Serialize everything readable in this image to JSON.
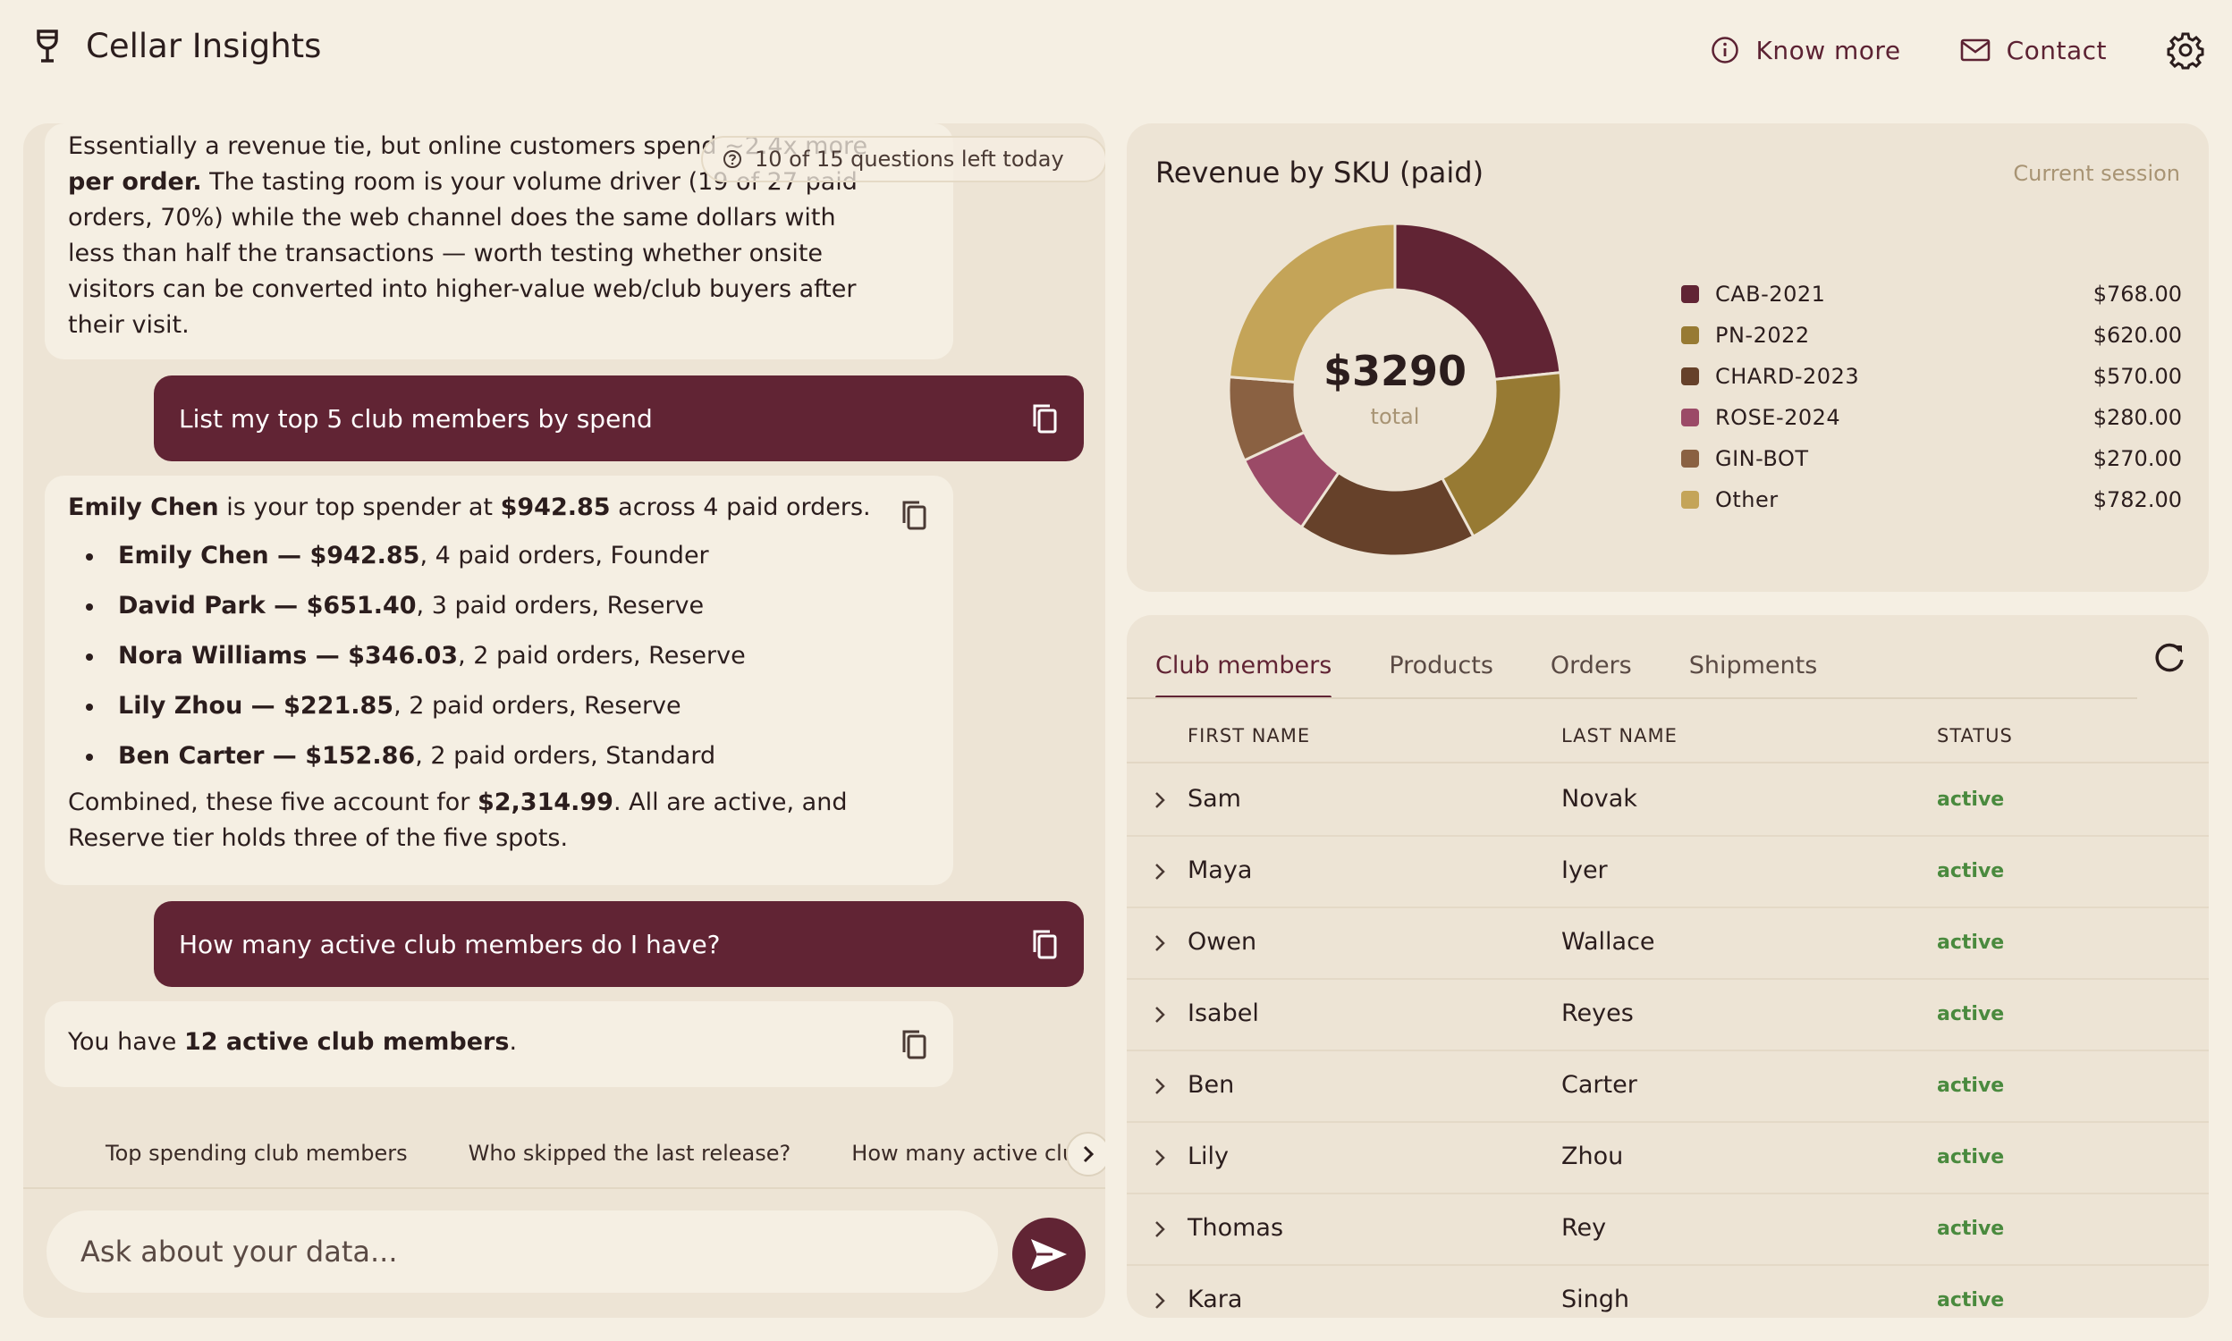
{
  "app": {
    "title": "Cellar Insights"
  },
  "header": {
    "know_more": "Know more",
    "contact": "Contact"
  },
  "quota": "10 of 15 questions left today",
  "chat": {
    "msg1_lines": [
      "Essentially a revenue tie, but online customers spend ~2.4x more",
      "per order.",
      " The tasting room is your volume driver (19 of 27 paid",
      "orders, 70%) while the web channel does the same dollars with",
      "less than half the transactions — worth testing whether onsite",
      "visitors can be converted into higher-value web/club buyers after",
      "their visit."
    ],
    "user1": "List my top 5 club members by spend",
    "msg2": {
      "p1_name": "Emily Chen",
      "p1_mid": " is your top spender at ",
      "p1_amount": "$942.85",
      "p1_end": " across 4 paid orders.",
      "items": [
        {
          "bold": "Emily Chen — $942.85",
          "rest": ", 4 paid orders, Founder"
        },
        {
          "bold": "David Park — $651.40",
          "rest": ", 3 paid orders, Reserve"
        },
        {
          "bold": "Nora Williams — $346.03",
          "rest": ", 2 paid orders, Reserve"
        },
        {
          "bold": "Lily Zhou — $221.85",
          "rest": ", 2 paid orders, Reserve"
        },
        {
          "bold": "Ben Carter — $152.86",
          "rest": ", 2 paid orders, Standard"
        }
      ],
      "summary_a": "Combined, these five account for ",
      "summary_amount": "$2,314.99",
      "summary_b": ". All are active, and",
      "summary_c": "Reserve tier holds three of the five spots."
    },
    "user2": "How many active club members do I have?",
    "msg3_a": "You have ",
    "msg3_b": "12 active club members",
    "msg3_c": ".",
    "suggestions": [
      "Top spending club members",
      "Who skipped the last release?",
      "How many active club members do I have?"
    ],
    "input_placeholder": "Ask about your data..."
  },
  "revenue": {
    "title": "Revenue by SKU (paid)",
    "session": "Current session",
    "total": "$3290",
    "total_label": "total",
    "legend_values": [
      "$768.00",
      "$620.00",
      "$570.00",
      "$280.00",
      "$270.00",
      "$782.00"
    ]
  },
  "chart_data": {
    "type": "pie",
    "title": "Revenue by SKU (paid)",
    "categories": [
      "CAB-2021",
      "PN-2022",
      "CHARD-2023",
      "ROSE-2024",
      "GIN-BOT",
      "Other"
    ],
    "values": [
      768,
      620,
      570,
      280,
      270,
      782
    ],
    "colors": [
      "#612434",
      "#977a33",
      "#66412a",
      "#9b4a67",
      "#8a6142",
      "#c4a458"
    ]
  },
  "members": {
    "tabs": [
      "Club members",
      "Products",
      "Orders",
      "Shipments"
    ],
    "columns": [
      "FIRST NAME",
      "LAST NAME",
      "STATUS"
    ],
    "rows": [
      {
        "first": "Sam",
        "last": "Novak",
        "status": "active"
      },
      {
        "first": "Maya",
        "last": "Iyer",
        "status": "active"
      },
      {
        "first": "Owen",
        "last": "Wallace",
        "status": "active"
      },
      {
        "first": "Isabel",
        "last": "Reyes",
        "status": "active"
      },
      {
        "first": "Ben",
        "last": "Carter",
        "status": "active"
      },
      {
        "first": "Lily",
        "last": "Zhou",
        "status": "active"
      },
      {
        "first": "Thomas",
        "last": "Rey",
        "status": "active"
      },
      {
        "first": "Kara",
        "last": "Singh",
        "status": "active"
      }
    ]
  },
  "icons": {
    "brand": "wine-glass-icon",
    "info": "info-icon",
    "mail": "mail-icon",
    "settings": "gear-icon",
    "copy": "copy-icon",
    "send": "send-icon",
    "refresh": "refresh-icon",
    "chevron": "chevron-right-icon"
  }
}
